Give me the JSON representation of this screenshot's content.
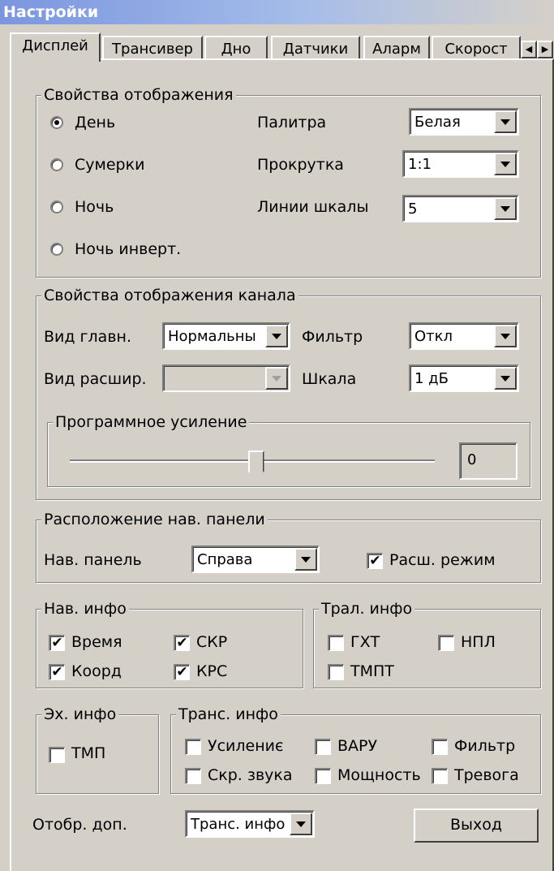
{
  "window": {
    "title": "Настройки"
  },
  "tabs": [
    {
      "label": "Дисплей",
      "active": true
    },
    {
      "label": "Трансивер"
    },
    {
      "label": "Дно"
    },
    {
      "label": "Датчики"
    },
    {
      "label": "Аларм"
    },
    {
      "label": "Скорост"
    }
  ],
  "display_props": {
    "legend": "Свойства отображения",
    "modes": [
      {
        "label": "День",
        "selected": true
      },
      {
        "label": "Сумерки",
        "selected": false
      },
      {
        "label": "Ночь",
        "selected": false
      },
      {
        "label": "Ночь инверт.",
        "selected": false
      }
    ],
    "palette_label": "Палитра",
    "palette_value": "Белая",
    "scroll_label": "Прокрутка",
    "scroll_value": "1:1",
    "scale_lines_label": "Линии шкалы",
    "scale_lines_value": "5"
  },
  "channel_props": {
    "legend": "Свойства отображения канала",
    "main_view_label": "Вид главн.",
    "main_view_value": "Нормальны",
    "ext_view_label": "Вид расшир.",
    "ext_view_value": "",
    "filter_label": "Фильтр",
    "filter_value": "Откл",
    "scale_label": "Шкала",
    "scale_value": "1 дБ",
    "gain": {
      "legend": "Программное усиление",
      "value": "0",
      "slider_fraction": 0.51
    }
  },
  "nav_panel": {
    "legend": "Расположение нав. панели",
    "label": "Нав. панель",
    "value": "Справа",
    "ext_mode_label": "Расш. режим",
    "ext_mode_checked": true
  },
  "nav_info": {
    "legend": "Нав. инфо",
    "items": [
      {
        "label": "Время",
        "checked": true
      },
      {
        "label": "СКР",
        "checked": true
      },
      {
        "label": "Коорд",
        "checked": true
      },
      {
        "label": "КРС",
        "checked": true
      }
    ]
  },
  "trawl_info": {
    "legend": "Трал. инфо",
    "items": [
      {
        "label": "ГХТ",
        "checked": false
      },
      {
        "label": "НПЛ",
        "checked": false
      },
      {
        "label": "ТМПТ",
        "checked": false
      }
    ]
  },
  "echo_info": {
    "legend": "Эх. инфо",
    "items": [
      {
        "label": "ТМП",
        "checked": false
      }
    ]
  },
  "trans_info": {
    "legend": "Транс. инфо",
    "items": [
      {
        "label": "Усилениє",
        "checked": false
      },
      {
        "label": "ВАРУ",
        "checked": false
      },
      {
        "label": "Фильтр",
        "checked": false
      },
      {
        "label": "Скр. звука",
        "checked": false
      },
      {
        "label": "Мощность",
        "checked": false
      },
      {
        "label": "Тревога",
        "checked": false
      }
    ]
  },
  "footer": {
    "extra_label": "Отобр. доп.",
    "extra_value": "Транс. инфо",
    "exit_label": "Выход"
  },
  "icons": {
    "check_glyph": "✔",
    "scroll_left": "◀",
    "scroll_right": "▶"
  }
}
